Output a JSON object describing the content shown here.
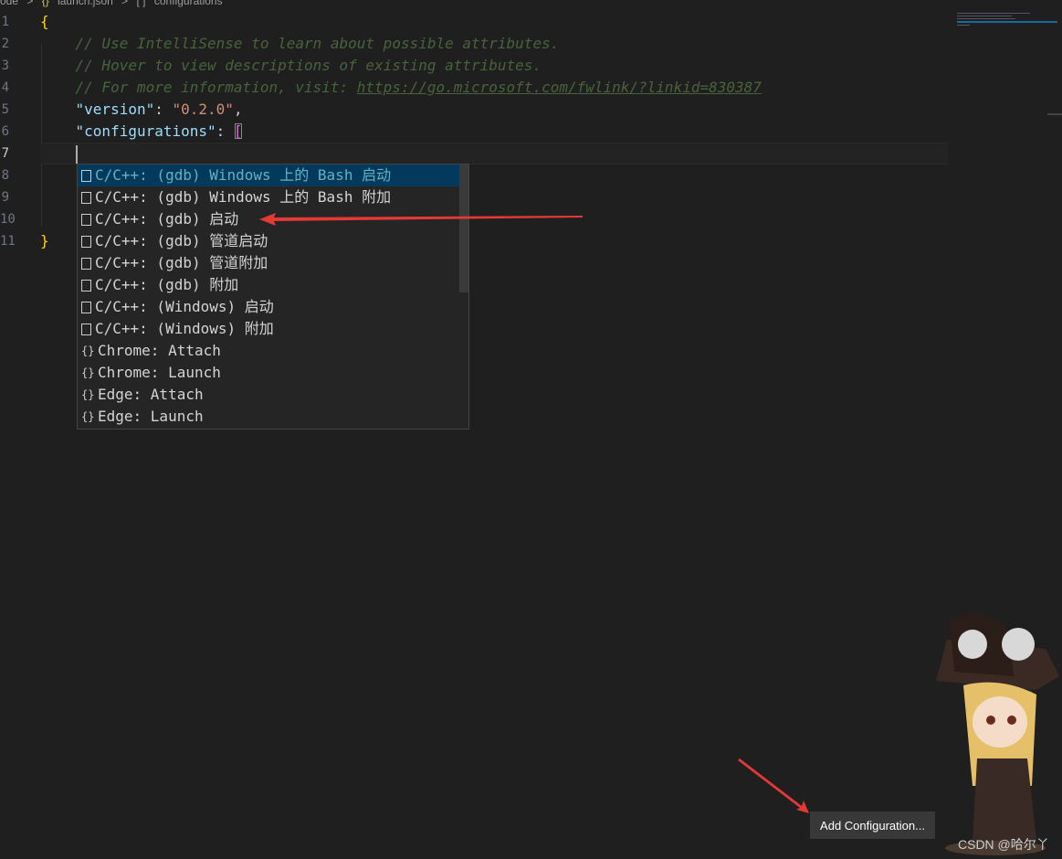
{
  "breadcrumb": [
    "ode",
    ">",
    "{}",
    "launch.json",
    ">",
    "[ ]",
    "configurations"
  ],
  "editor": {
    "line_numbers": [
      "1",
      "2",
      "3",
      "4",
      "5",
      "6",
      "7",
      "8",
      "9",
      "10",
      "11"
    ],
    "active_line": "7",
    "comments": [
      "// Use IntelliSense to learn about possible attributes.",
      "// Hover to view descriptions of existing attributes.",
      "// For more information, visit: "
    ],
    "link": "https://go.microsoft.com/fwlink/?linkid=830387",
    "version_key": "\"version\"",
    "version_value": "\"0.2.0\"",
    "configurations_key": "\"configurations\"",
    "open_brace": "{",
    "close_brace": "}",
    "open_bracket": "[",
    "colon": ": ",
    "comma": ","
  },
  "suggestions": [
    {
      "icon": "snippet-box-icon",
      "label": "C/C++: (gdb) Windows 上的 Bash 启动"
    },
    {
      "icon": "snippet-box-icon",
      "label": "C/C++: (gdb) Windows 上的 Bash 附加"
    },
    {
      "icon": "snippet-box-icon",
      "label": "C/C++: (gdb) 启动"
    },
    {
      "icon": "snippet-box-icon",
      "label": "C/C++: (gdb) 管道启动"
    },
    {
      "icon": "snippet-box-icon",
      "label": "C/C++: (gdb) 管道附加"
    },
    {
      "icon": "snippet-box-icon",
      "label": "C/C++: (gdb) 附加"
    },
    {
      "icon": "snippet-box-icon",
      "label": "C/C++: (Windows) 启动"
    },
    {
      "icon": "snippet-box-icon",
      "label": "C/C++: (Windows) 附加"
    },
    {
      "icon": "braces-icon",
      "label": "Chrome: Attach"
    },
    {
      "icon": "braces-icon",
      "label": "Chrome: Launch"
    },
    {
      "icon": "braces-icon",
      "label": "Edge: Attach"
    },
    {
      "icon": "braces-icon",
      "label": "Edge: Launch"
    }
  ],
  "braces_glyph": "{}",
  "add_configuration_label": "Add Configuration...",
  "watermark": "CSDN @哈尔丫",
  "colors": {
    "background": "#1f1f1f",
    "arrow": "#e53935",
    "selection": "#04395e"
  }
}
